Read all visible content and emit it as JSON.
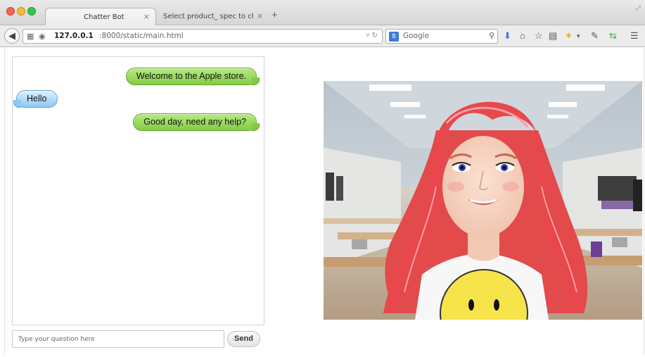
{
  "browser": {
    "tabs": [
      {
        "label": "Chatter Bot",
        "active": true
      },
      {
        "label": "Select product_ spec to chang...",
        "active": false
      }
    ],
    "new_tab": "+",
    "tab_close": "×",
    "url_host": "127.0.0.1",
    "url_path": ":8000/static/main.html",
    "search_engine": "8",
    "search_placeholder": "Google",
    "icons": [
      "back-arrow-icon",
      "grid-icon",
      "globe-icon",
      "reload-icon",
      "search-icon",
      "download-icon",
      "home-icon",
      "bookmark-star-icon",
      "reading-list-icon",
      "extension-icon",
      "plugin-icon",
      "sync-icon",
      "menu-icon"
    ]
  },
  "chat": {
    "messages": [
      {
        "from": "bot",
        "text": "Welcome to the Apple store."
      },
      {
        "from": "user",
        "text": "Hello"
      },
      {
        "from": "bot",
        "text": "Good day, need any help?"
      }
    ],
    "input_placeholder": "Type your question here",
    "input_value": "",
    "send_label": "Send"
  },
  "colors": {
    "bot_bubble": "#83cb45",
    "user_bubble": "#8ec8f4",
    "avatar_hair": "#e8474b",
    "smiley": "#f7e34a"
  }
}
